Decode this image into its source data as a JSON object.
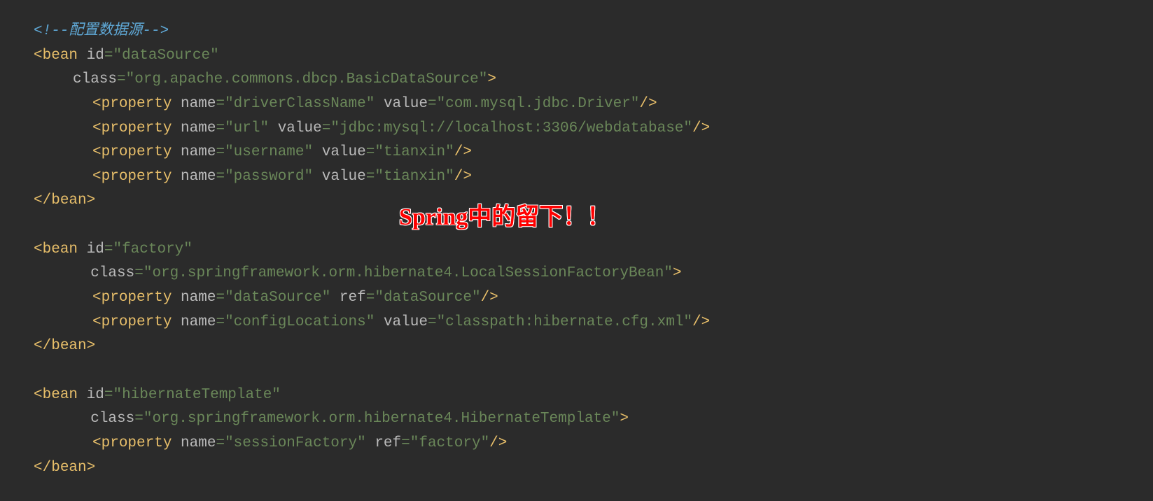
{
  "annotation": "Spring中的留下！！",
  "comment": "<!--配置数据源-->",
  "bean1": {
    "tag": "bean",
    "idAttr": "id",
    "idVal": "\"dataSource\"",
    "classAttr": "class",
    "classVal": "\"org.apache.commons.dbcp.BasicDataSource\"",
    "props": [
      {
        "tag": "property",
        "nameAttr": "name",
        "nameVal": "\"driverClassName\"",
        "valAttr": "value",
        "valVal": "\"com.mysql.jdbc.Driver\""
      },
      {
        "tag": "property",
        "nameAttr": "name",
        "nameVal": "\"url\"",
        "valAttr": "value",
        "valVal": "\"jdbc:mysql://localhost:3306/webdatabase\""
      },
      {
        "tag": "property",
        "nameAttr": "name",
        "nameVal": "\"username\"",
        "valAttr": "value",
        "valVal": "\"tianxin\""
      },
      {
        "tag": "property",
        "nameAttr": "name",
        "nameVal": "\"password\"",
        "valAttr": "value",
        "valVal": "\"tianxin\""
      }
    ],
    "closeTag": "bean"
  },
  "bean2": {
    "tag": "bean",
    "idAttr": "id",
    "idVal": "\"factory\"",
    "classAttr": "class",
    "classVal": "\"org.springframework.orm.hibernate4.LocalSessionFactoryBean\"",
    "props": [
      {
        "tag": "property",
        "nameAttr": "name",
        "nameVal": "\"dataSource\"",
        "valAttr": "ref",
        "valVal": "\"dataSource\""
      },
      {
        "tag": "property",
        "nameAttr": "name",
        "nameVal": "\"configLocations\"",
        "valAttr": "value",
        "valVal": "\"classpath:hibernate.cfg.xml\""
      }
    ],
    "closeTag": "bean"
  },
  "bean3": {
    "tag": "bean",
    "idAttr": "id",
    "idVal": "\"hibernateTemplate\"",
    "classAttr": "class",
    "classVal": "\"org.springframework.orm.hibernate4.HibernateTemplate\"",
    "props": [
      {
        "tag": "property",
        "nameAttr": "name",
        "nameVal": "\"sessionFactory\"",
        "valAttr": "ref",
        "valVal": "\"factory\""
      }
    ],
    "closeTag": "bean"
  }
}
